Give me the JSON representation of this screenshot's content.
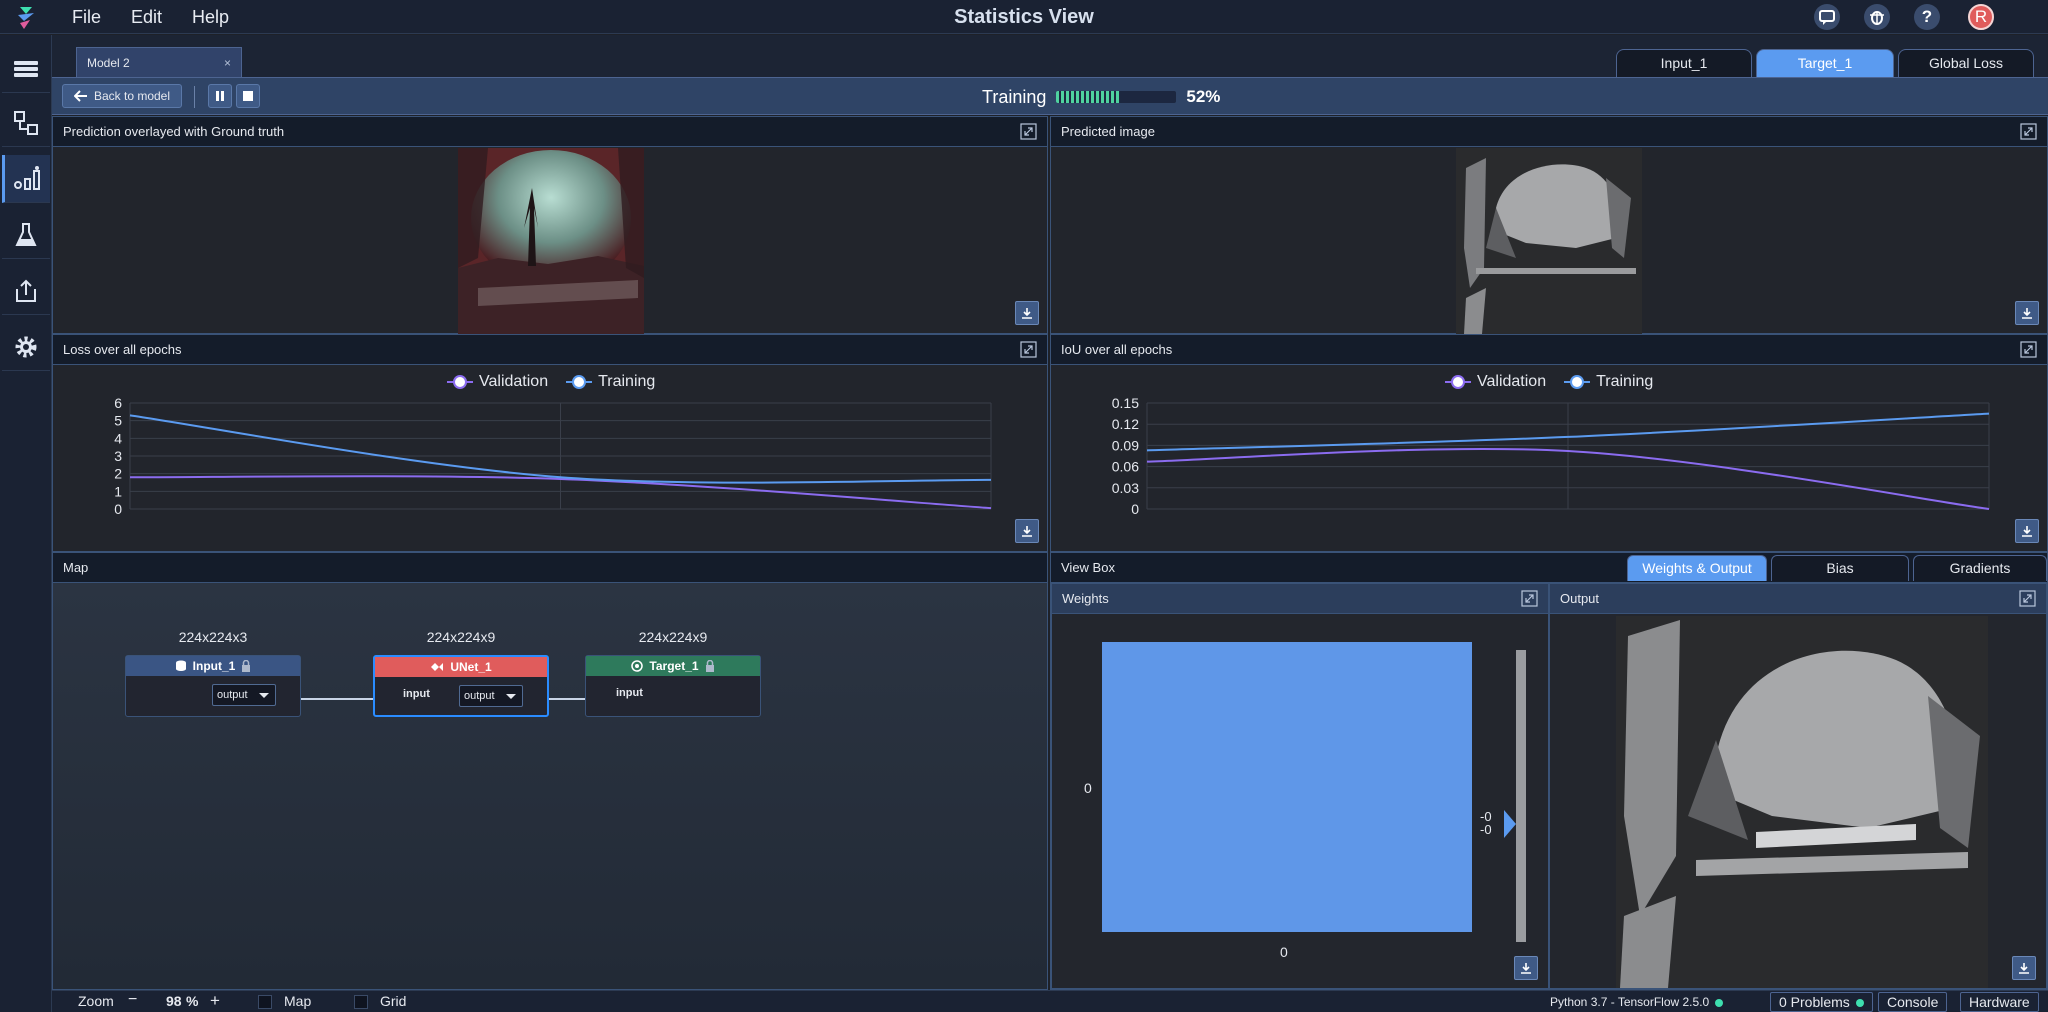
{
  "app": {
    "title": "Statistics View",
    "menu": [
      "File",
      "Edit",
      "Help"
    ],
    "avatar_letter": "R"
  },
  "model_tab": {
    "label": "Model 2",
    "close": "×"
  },
  "top_tabs": [
    {
      "label": "Input_1",
      "active": false
    },
    {
      "label": "Target_1",
      "active": true
    },
    {
      "label": "Global Loss",
      "active": false
    }
  ],
  "toolbar": {
    "back_label": "Back to model",
    "training_label": "Training",
    "progress_percent": 52,
    "progress_text": "52%"
  },
  "panels": {
    "prediction": "Prediction overlayed with Ground truth",
    "predicted": "Predicted image",
    "loss": "Loss over all epochs",
    "iou": "IoU over all epochs",
    "map": "Map",
    "viewbox": "View Box",
    "weights": "Weights",
    "output": "Output"
  },
  "legend": {
    "validation": "Validation",
    "training": "Training"
  },
  "colors": {
    "validation": "#8b6cf0",
    "training": "#5b9bf0",
    "accent": "#5b9bf0"
  },
  "chart_data": [
    {
      "type": "line",
      "title": "Loss over all epochs",
      "x": [
        0,
        1,
        2
      ],
      "xlim": [
        0,
        2
      ],
      "ylim": [
        0,
        6
      ],
      "yticks": [
        "0",
        "1",
        "2",
        "3",
        "4",
        "5",
        "6"
      ],
      "xticks": [
        "0",
        "1",
        "2"
      ],
      "series": [
        {
          "name": "Validation",
          "values": [
            1.8,
            1.7,
            0.05
          ]
        },
        {
          "name": "Training",
          "values": [
            5.3,
            1.8,
            1.65
          ]
        }
      ]
    },
    {
      "type": "line",
      "title": "IoU over all epochs",
      "x": [
        0,
        1,
        2
      ],
      "xlim": [
        0,
        2
      ],
      "ylim": [
        0,
        0.15
      ],
      "yticks": [
        "0",
        "0.03",
        "0.06",
        "0.09",
        "0.12",
        "0.15"
      ],
      "xticks": [
        "0",
        "1",
        "2"
      ],
      "series": [
        {
          "name": "Validation",
          "values": [
            0.067,
            0.082,
            0.0
          ]
        },
        {
          "name": "Training",
          "values": [
            0.083,
            0.102,
            0.135
          ]
        }
      ]
    }
  ],
  "map": {
    "nodes": [
      {
        "name": "Input_1",
        "dim": "224x224x3",
        "out": "output"
      },
      {
        "name": "UNet_1",
        "dim": "224x224x9",
        "in": "input",
        "out": "output"
      },
      {
        "name": "Target_1",
        "dim": "224x224x9",
        "in": "input"
      }
    ]
  },
  "viewbox_tabs": [
    {
      "label": "Weights & Output",
      "active": true
    },
    {
      "label": "Bias",
      "active": false
    },
    {
      "label": "Gradients",
      "active": false
    }
  ],
  "weights": {
    "y_label": "0",
    "x_label": "0",
    "scale_top": "-0",
    "scale_bottom": "-0"
  },
  "statusbar": {
    "zoom_label": "Zoom",
    "zoom_minus": "−",
    "zoom_value": "98",
    "zoom_unit": "%",
    "zoom_plus": "+",
    "map_label": "Map",
    "grid_label": "Grid",
    "env": "Python 3.7 - TensorFlow 2.5.0",
    "problems": "0 Problems",
    "console": "Console",
    "hardware": "Hardware"
  }
}
